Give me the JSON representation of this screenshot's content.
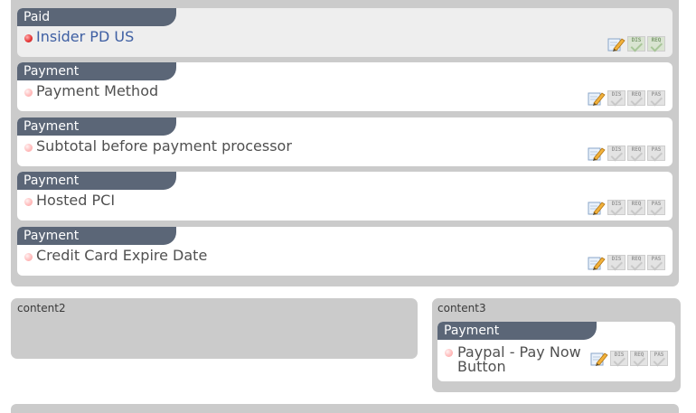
{
  "cards": [
    {
      "tab": "Paid",
      "title": "Insider PD US",
      "active": true
    },
    {
      "tab": "Payment",
      "title": "Payment Method",
      "active": false
    },
    {
      "tab": "Payment",
      "title": "Subtotal before payment processor",
      "active": false
    },
    {
      "tab": "Payment",
      "title": "Hosted PCI",
      "active": false
    },
    {
      "tab": "Payment",
      "title": "Credit Card Expire Date",
      "active": false
    }
  ],
  "action_labels": {
    "edit": "edit",
    "dis": "DIS",
    "req": "REQ",
    "pas": "PAS"
  },
  "content2": {
    "label": "content2"
  },
  "content3": {
    "label": "content3",
    "card": {
      "tab": "Payment",
      "title": "Paypal - Pay Now Button"
    }
  },
  "colors": {
    "panel": "#cbcbcb",
    "tab": "#5b6677",
    "active_title": "#3e5fa3",
    "title": "#505050"
  }
}
